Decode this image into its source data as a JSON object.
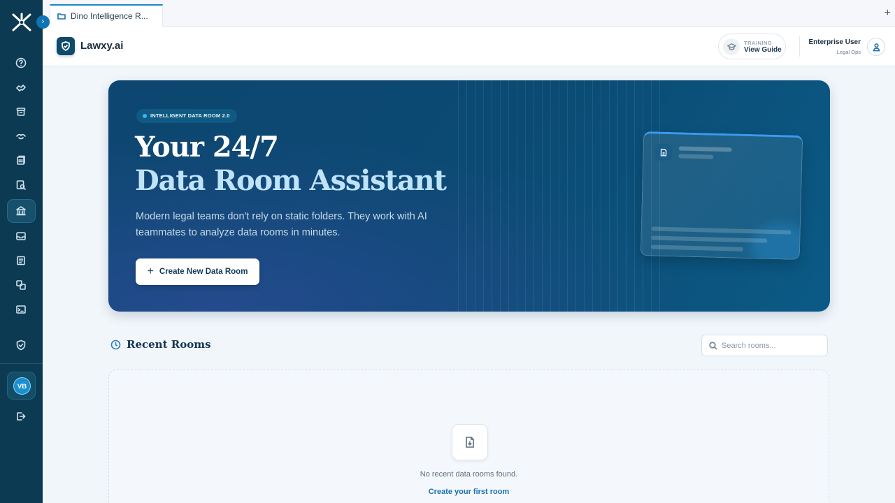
{
  "tab": {
    "title": "Dino Intelligence R...",
    "new_tab_symbol": "+"
  },
  "header": {
    "brand": "Lawxy.ai",
    "training_label": "TRAINING",
    "training_action": "View Guide",
    "user_name": "Enterprise User",
    "user_role": "Legal Ops"
  },
  "sidebar": {
    "collapse_symbol": "›",
    "items": [
      {
        "icon": "help-icon"
      },
      {
        "icon": "handshake-icon"
      },
      {
        "icon": "archive-icon"
      },
      {
        "icon": "hands-icon"
      },
      {
        "icon": "documents-icon"
      },
      {
        "icon": "document-search-icon"
      },
      {
        "icon": "data-room-icon",
        "active": true
      },
      {
        "icon": "inbox-icon"
      },
      {
        "icon": "clipboard-icon"
      },
      {
        "icon": "translate-icon"
      },
      {
        "icon": "terminal-icon"
      },
      {
        "icon": "shield-check-icon"
      }
    ],
    "avatar_initials": "VB",
    "logout_icon": "logout-icon"
  },
  "hero": {
    "badge": "INTELLIGENT DATA ROOM 2.0",
    "title_line1": "Your 24/7",
    "title_line2": "Data Room Assistant",
    "description": "Modern legal teams don't rely on static folders. They work with AI teammates to analyze data rooms in minutes.",
    "button_label": "Create New Data Room",
    "button_icon": "+"
  },
  "recent": {
    "title": "Recent Rooms",
    "search_placeholder": "Search rooms...",
    "empty_text": "No recent data rooms found.",
    "empty_link": "Create your first room"
  },
  "colors": {
    "sidebar_bg": "#0c3a52",
    "accent": "#1787c9",
    "hero_bg": "#0b4a72",
    "hero_highlight": "#bfe3f9"
  }
}
